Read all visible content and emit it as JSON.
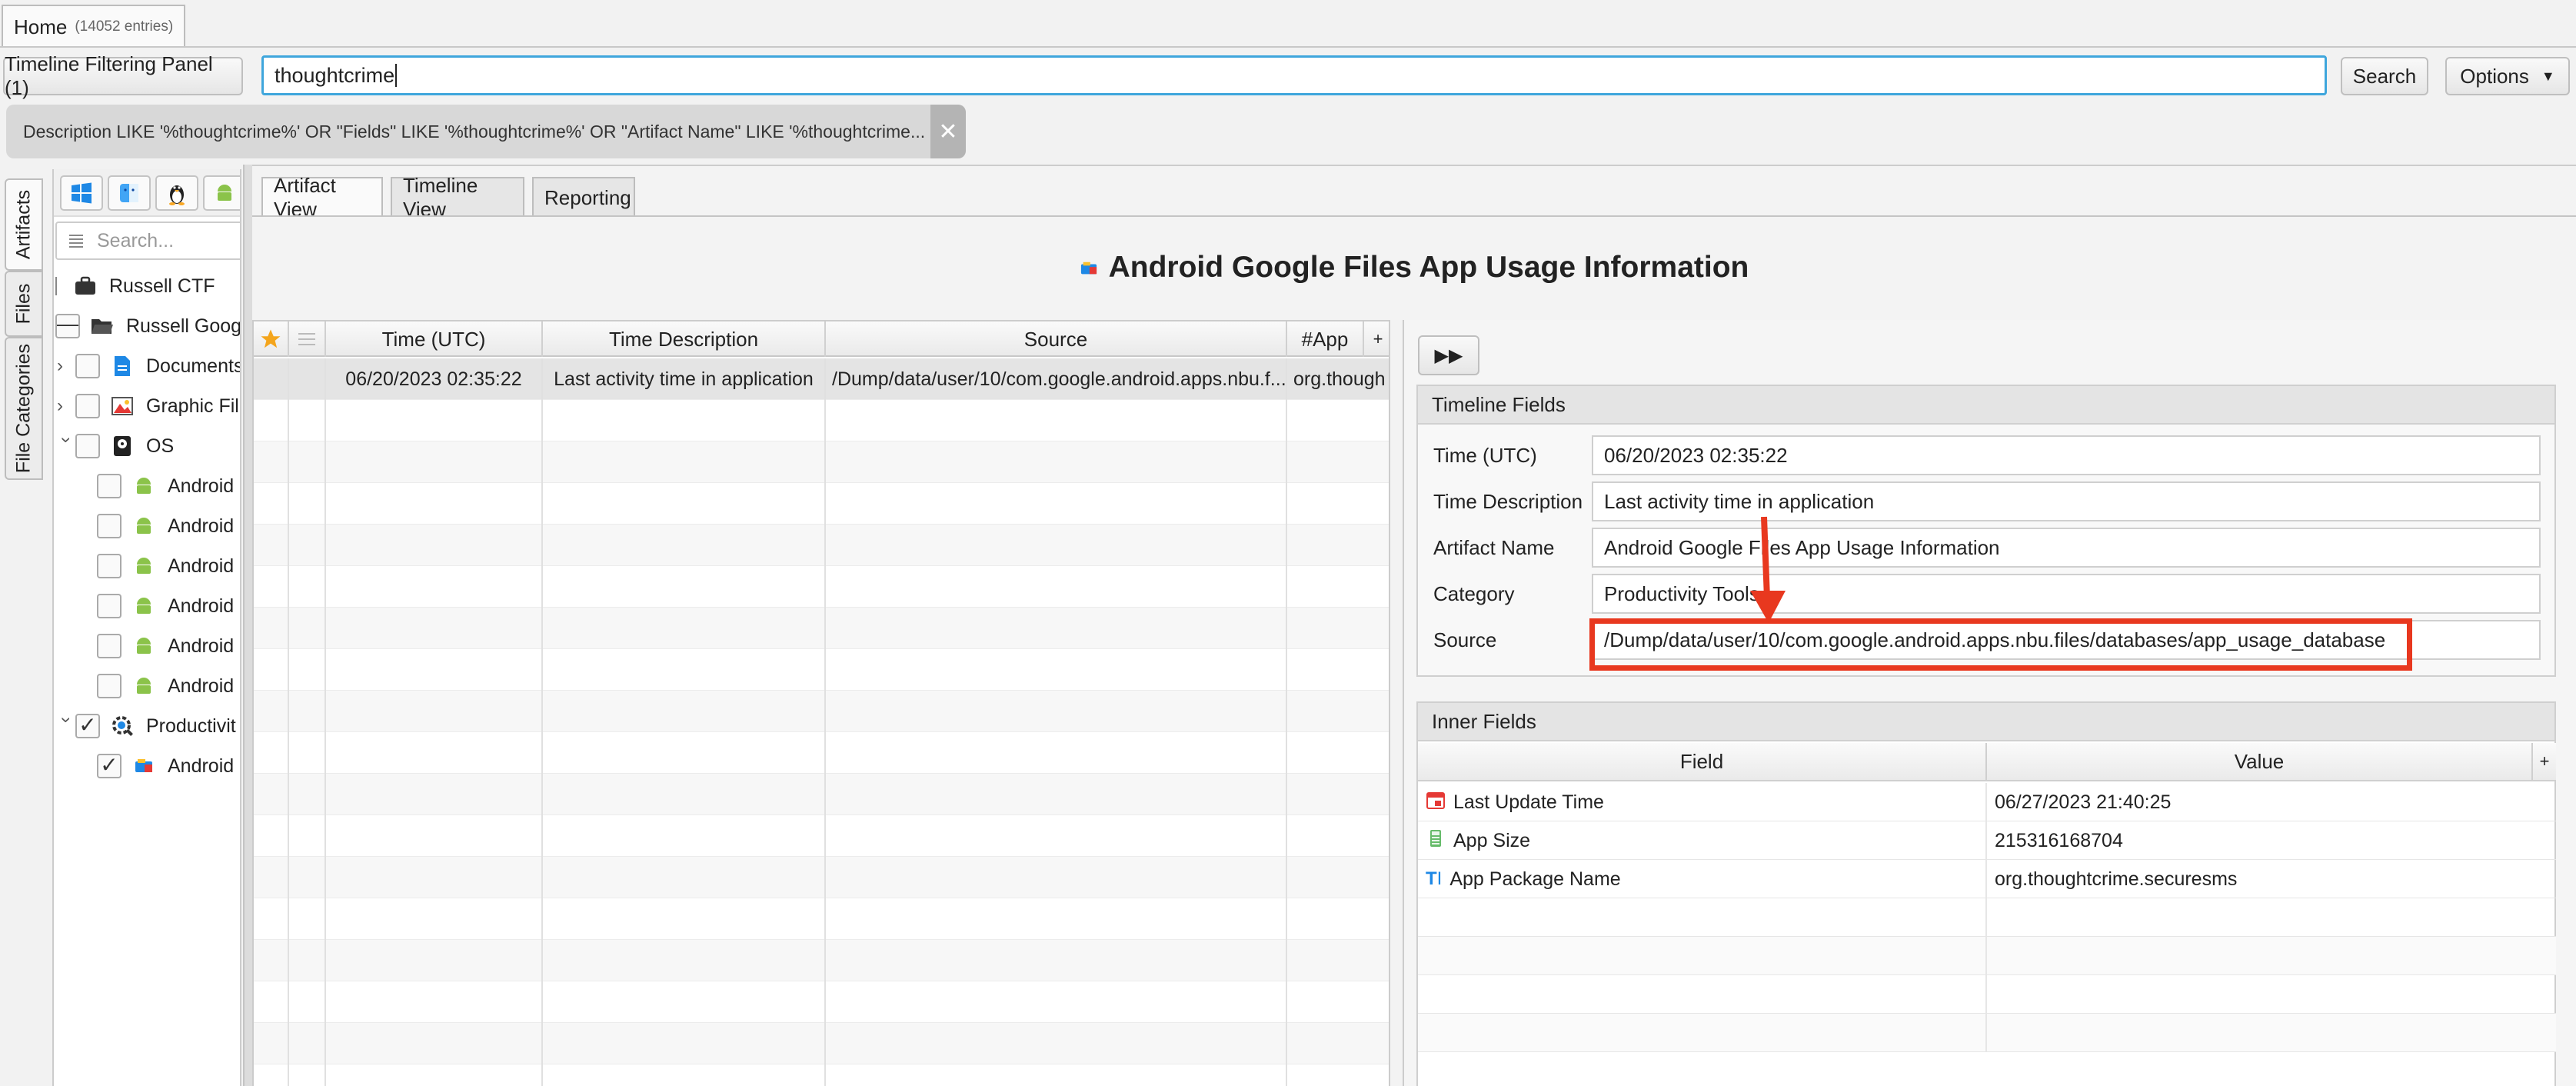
{
  "top": {
    "tab_label": "Home",
    "tab_count": "(14052 entries)"
  },
  "toolbar": {
    "filter_panel_label": "Timeline Filtering Panel (1)",
    "search_value": "thoughtcrime",
    "search_label": "Search",
    "options_label": "Options"
  },
  "filter_chip": {
    "text": "Description LIKE '%thoughtcrime%' OR \"Fields\" LIKE '%thoughtcrime%' OR \"Artifact Name\" LIKE '%thoughtcrime...",
    "close": "✕"
  },
  "side_tabs": [
    "Artifacts",
    "Files",
    "File Categories"
  ],
  "left": {
    "search_placeholder": "Search...",
    "tree": [
      {
        "label": "Russell CTF"
      },
      {
        "label": "Russell Goog"
      },
      {
        "label": "Documents"
      },
      {
        "label": "Graphic Fil"
      },
      {
        "label": "OS"
      },
      {
        "label": "Android"
      },
      {
        "label": "Android"
      },
      {
        "label": "Android"
      },
      {
        "label": "Android"
      },
      {
        "label": "Android"
      },
      {
        "label": "Android"
      },
      {
        "label": "Productivit"
      },
      {
        "label": "Android"
      }
    ]
  },
  "main": {
    "tabs": [
      "Artifact View",
      "Timeline View",
      "Reporting"
    ],
    "title": "Android Google Files App Usage Information",
    "table": {
      "headers": [
        "Time (UTC)",
        "Time Description",
        "Source",
        "#App"
      ],
      "row": {
        "time": "06/20/2023 02:35:22",
        "desc": "Last activity time in application",
        "source": "/Dump/data/user/10/com.google.android.apps.nbu.f...",
        "app": "org.though"
      }
    }
  },
  "detail": {
    "ff_label": "▶▶",
    "timeline_fields_title": "Timeline Fields",
    "fields": [
      {
        "label": "Time (UTC)",
        "value": "06/20/2023 02:35:22"
      },
      {
        "label": "Time Description",
        "value": "Last activity time in application"
      },
      {
        "label": "Artifact Name",
        "value": "Android Google Files App Usage Information"
      },
      {
        "label": "Category",
        "value": "Productivity Tools"
      },
      {
        "label": "Source",
        "value": "/Dump/data/user/10/com.google.android.apps.nbu.files/databases/app_usage_database"
      }
    ],
    "inner_fields_title": "Inner Fields",
    "inner_headers": [
      "Field",
      "Value"
    ],
    "inner_rows": [
      {
        "field": "Last Update Time",
        "value": "06/27/2023 21:40:25"
      },
      {
        "field": "App Size",
        "value": "215316168704"
      },
      {
        "field": "App Package Name",
        "value": "org.thoughtcrime.securesms"
      }
    ]
  },
  "colors": {
    "accent": "#3fa6dc",
    "highlight": "#e8381f",
    "android": "#8bc34a"
  }
}
